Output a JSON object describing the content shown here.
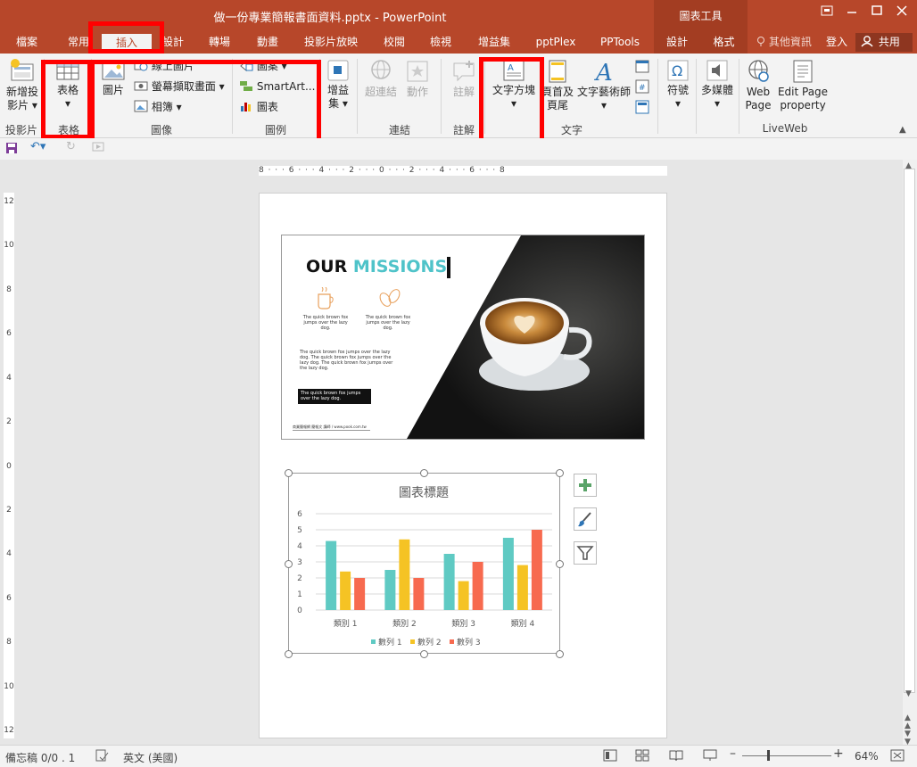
{
  "window": {
    "title": "做一份專業簡報書面資料.pptx - PowerPoint",
    "context_tools": "圖表工具",
    "colors": {
      "accent": "#b7472a",
      "accent_dark": "#a33d22",
      "highlight": "#ff0000"
    }
  },
  "tabs": [
    {
      "label": "檔案"
    },
    {
      "label": "常用"
    },
    {
      "label": "插入"
    },
    {
      "label": "設計"
    },
    {
      "label": "轉場"
    },
    {
      "label": "動畫"
    },
    {
      "label": "投影片放映"
    },
    {
      "label": "校閱"
    },
    {
      "label": "檢視"
    },
    {
      "label": "增益集"
    },
    {
      "label": "pptPlex"
    },
    {
      "label": "PPTools"
    },
    {
      "label": "設計"
    },
    {
      "label": "格式"
    }
  ],
  "tellme": "其他資訊",
  "signin": "登入",
  "share": "共用",
  "ribbon": {
    "new_slide": {
      "line1": "新增投",
      "line2": "影片"
    },
    "group_slides": "投影片",
    "table": "表格",
    "group_tables": "表格",
    "picture": "圖片",
    "online_pictures": "線上圖片",
    "screenshot": "螢幕擷取畫面",
    "album": "相簿",
    "group_images": "圖像",
    "shapes": "圖案",
    "smartart": "SmartArt...",
    "chart": "圖表",
    "group_illustrations": "圖例",
    "addins": {
      "line1": "增益",
      "line2": "集"
    },
    "hyperlink": "超連結",
    "action": "動作",
    "group_links": "連結",
    "comment": "註解",
    "group_comments": "註解",
    "textbox": "文字方塊",
    "header_footer": {
      "line1": "頁首及",
      "line2": "頁尾"
    },
    "wordart": "文字藝術師",
    "group_text": "文字",
    "symbols": "符號",
    "media": "多媒體",
    "webpage": {
      "line1": "Web",
      "line2": "Page"
    },
    "edit_page": {
      "line1": "Edit Page",
      "line2": "property"
    },
    "group_liveweb": "LiveWeb"
  },
  "hruler_text": "8 · · · 6 · · · 4 · · · 2 · · · 0 · · · 2 · · · 4 · · · 6 · · · 8",
  "vruler_labels": [
    "12",
    "10",
    "8",
    "6",
    "4",
    "2",
    "0",
    "2",
    "4",
    "6",
    "8",
    "10",
    "12"
  ],
  "slide": {
    "heading_part1": "OUR ",
    "heading_part2": "MISSIONS",
    "icon_text_1": "The quick brown fox jumps over the lazy dog.",
    "icon_text_2": "The quick brown fox jumps over the lazy dog.",
    "body_text": "The quick brown fox jumps over the lazy dog. The quick brown fox jumps over the lazy dog. The quick brown fox jumps over the lazy dog.",
    "box_text": "The quick brown fox jumps over the lazy dog.",
    "footer": "商業簡報網 簡報文 講師 / www.pook.com.tw",
    "accent": "#4fc3c9"
  },
  "chart_data": {
    "type": "bar",
    "title": "圖表標題",
    "categories": [
      "類別 1",
      "類別 2",
      "類別 3",
      "類別 4"
    ],
    "series": [
      {
        "name": "數列 1",
        "values": [
          4.3,
          2.5,
          3.5,
          4.5
        ],
        "color": "#5fcac3"
      },
      {
        "name": "數列 2",
        "values": [
          2.4,
          4.4,
          1.8,
          2.8
        ],
        "color": "#f5c324"
      },
      {
        "name": "數列 3",
        "values": [
          2,
          2,
          3,
          5
        ],
        "color": "#f76a4f"
      }
    ],
    "ylim": [
      0,
      6
    ],
    "yticks": [
      0,
      1,
      2,
      3,
      4,
      5,
      6
    ],
    "grid": true,
    "legend": "bottom"
  },
  "status": {
    "notes": "備忘稿 0/0 . 1",
    "language": "英文 (美國)",
    "zoom": "64%"
  }
}
